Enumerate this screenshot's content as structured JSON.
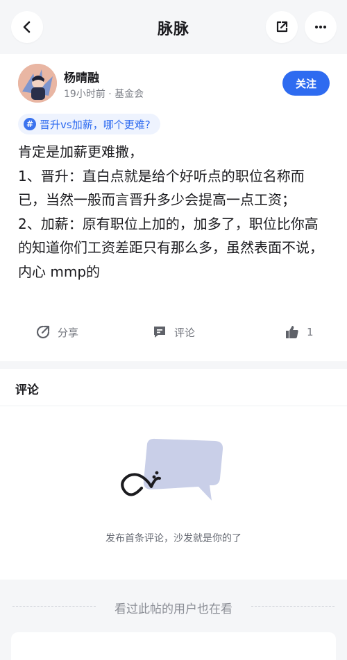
{
  "header": {
    "title": "脉脉",
    "back_icon": "chevron-left-icon",
    "share_icon": "share-box-icon",
    "more_icon": "more-dots-icon"
  },
  "post": {
    "author": {
      "name": "杨晴融",
      "meta": "19小时前 · 基金会"
    },
    "follow_label": "关注",
    "topic": {
      "hash": "#",
      "label": "晋升vs加薪，哪个更难?"
    },
    "body_lines": [
      "肯定是加薪更难撒，",
      "1、晋升：直白点就是给个好听点的职位名称而已，当然一般而言晋升多少会提高一点工资；",
      "2、加薪：原有职位上加的，加多了，职位比你高的知道你们工资差距只有那么多，虽然表面不说，内心 mmp的"
    ],
    "actions": {
      "share_label": "分享",
      "comment_label": "评论",
      "like_count": "1"
    }
  },
  "comments": {
    "title": "评论",
    "empty_text": "发布首条评论，沙发就是你的了"
  },
  "related": {
    "title": "看过此帖的用户也在看"
  },
  "colors": {
    "accent": "#2e6bf0",
    "background": "#f5f6f8",
    "empty_bubble": "#c9cfe8"
  }
}
